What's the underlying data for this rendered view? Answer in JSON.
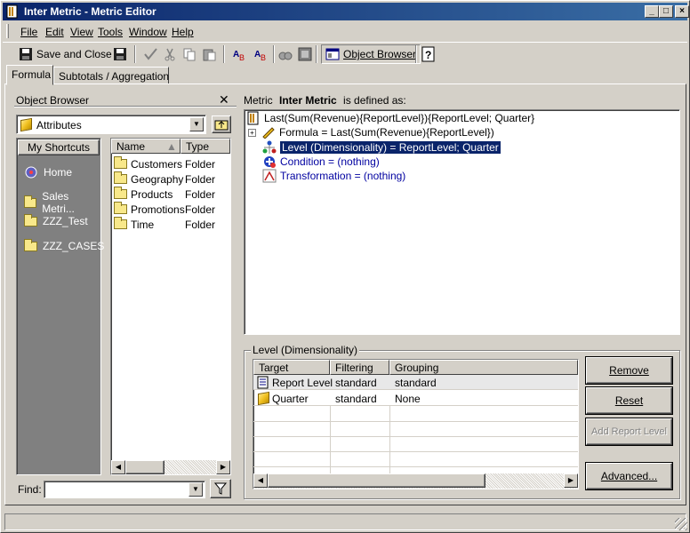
{
  "window": {
    "title": "Inter Metric - Metric Editor"
  },
  "menu": [
    "File",
    "Edit",
    "View",
    "Tools",
    "Window",
    "Help"
  ],
  "toolbar": {
    "save_close": "Save and Close",
    "object_browser": "Object Browser"
  },
  "tabs": [
    "Formula",
    "Subtotals / Aggregation"
  ],
  "object_browser": {
    "title": "Object Browser",
    "dropdown_value": "Attributes",
    "shortcuts_header": "My Shortcuts",
    "shortcuts": [
      "Home",
      "Sales Metri...",
      "ZZZ_Test",
      "ZZZ_CASES"
    ],
    "columns": [
      "Name",
      "Type"
    ],
    "items": [
      {
        "name": "Customers",
        "type": "Folder"
      },
      {
        "name": "Geography",
        "type": "Folder"
      },
      {
        "name": "Products",
        "type": "Folder"
      },
      {
        "name": "Promotions",
        "type": "Folder"
      },
      {
        "name": "Time",
        "type": "Folder"
      }
    ],
    "find_label": "Find:"
  },
  "definition": {
    "prefix": "Metric",
    "metric_name": "Inter Metric",
    "suffix": "is defined as:",
    "root": "Last(Sum(Revenue){ReportLevel}){ReportLevel; Quarter}",
    "formula": "Formula = Last(Sum(Revenue){ReportLevel})",
    "level": "Level (Dimensionality) = ReportLevel; Quarter",
    "condition": "Condition = (nothing)",
    "transformation": "Transformation = (nothing)"
  },
  "level_panel": {
    "title": "Level (Dimensionality)",
    "columns": [
      "Target",
      "Filtering",
      "Grouping"
    ],
    "rows": [
      {
        "target": "Report Level",
        "filtering": "standard",
        "grouping": "standard"
      },
      {
        "target": "Quarter",
        "filtering": "standard",
        "grouping": "None"
      }
    ],
    "buttons": {
      "remove": "Remove",
      "reset": "Reset",
      "add_report_level": "Add Report Level",
      "advanced": "Advanced..."
    }
  },
  "colors": {
    "title_start": "#0a246a",
    "title_end": "#3a6ea5",
    "selection": "#0a246a",
    "shortcut_bg": "#808080",
    "blue_text": "#0000a0"
  }
}
